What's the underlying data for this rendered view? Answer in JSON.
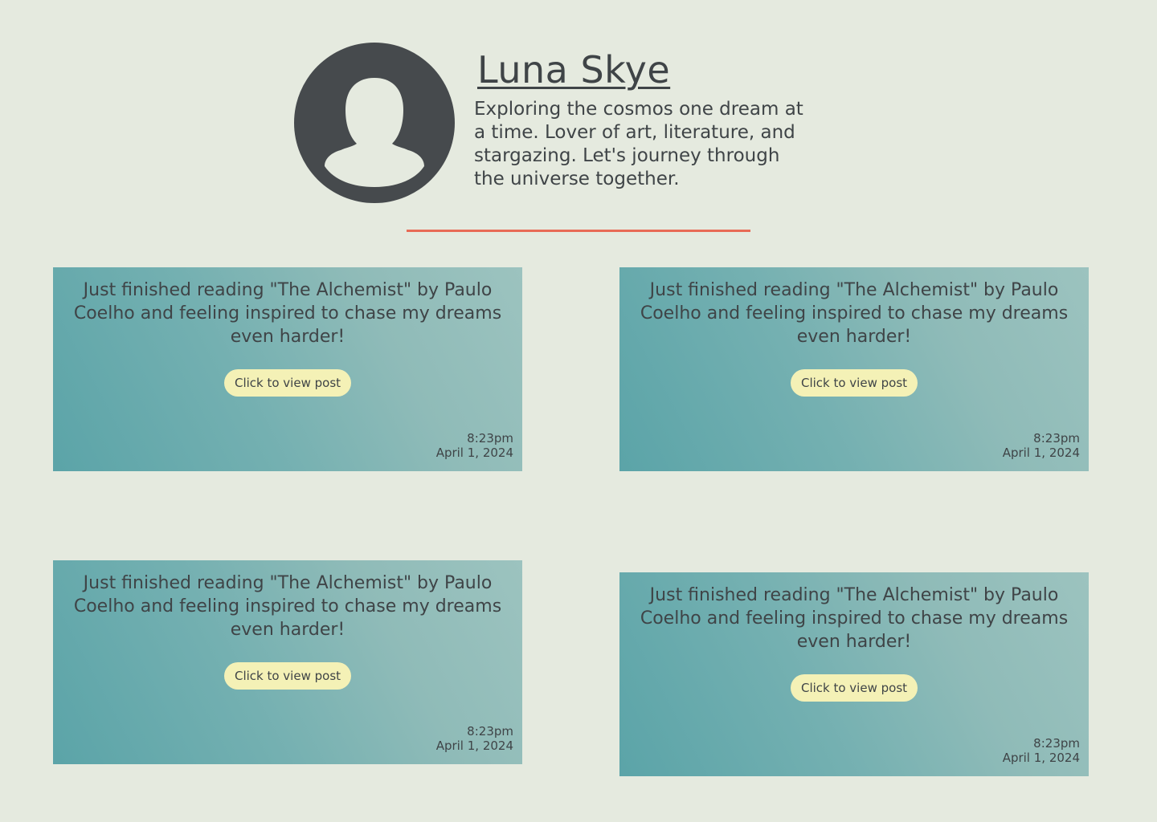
{
  "profile": {
    "name": "Luna Skye",
    "bio": "Exploring the cosmos one dream at a time. Lover of art, literature, and stargazing. Let's journey through the universe together.",
    "avatar_icon": "user-silhouette-icon"
  },
  "colors": {
    "background": "#e5eadf",
    "accent_divider": "#e86b56",
    "button": "#f4f1b6",
    "card_gradient_start": "#5ba4a8",
    "card_gradient_end": "#9cc3bf",
    "text": "#3f4447"
  },
  "posts": [
    {
      "text": "Just finished reading \"The Alchemist\" by Paulo Coelho and feeling inspired to chase my dreams even harder!",
      "button_label": "Click to view post",
      "time": "8:23pm",
      "date": "April 1, 2024"
    },
    {
      "text": "Just finished reading \"The Alchemist\" by Paulo Coelho and feeling inspired to chase my dreams even harder!",
      "button_label": "Click to view post",
      "time": "8:23pm",
      "date": "April 1, 2024"
    },
    {
      "text": "Just finished reading \"The Alchemist\" by Paulo Coelho and feeling inspired to chase my dreams even harder!",
      "button_label": "Click to view post",
      "time": "8:23pm",
      "date": "April 1, 2024"
    },
    {
      "text": "Just finished reading \"The Alchemist\" by Paulo Coelho and feeling inspired to chase my dreams even harder!",
      "button_label": "Click to view post",
      "time": "8:23pm",
      "date": "April 1, 2024"
    }
  ]
}
